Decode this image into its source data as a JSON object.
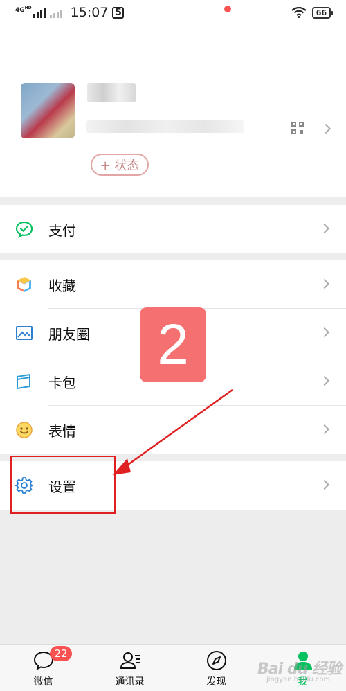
{
  "status_bar": {
    "network": "4G",
    "network_sup": "HD",
    "time": "15:07",
    "app_icon": "S",
    "battery": "66"
  },
  "profile": {
    "status_button": "+ 状态"
  },
  "menu": {
    "pay": "支付",
    "favorites": "收藏",
    "moments": "朋友圈",
    "cards": "卡包",
    "stickers": "表情",
    "settings": "设置"
  },
  "tabbar": {
    "chats": "微信",
    "chats_badge": "22",
    "contacts": "通讯录",
    "discover": "发现",
    "me": "我"
  },
  "annotation": {
    "step_number": "2"
  },
  "watermark": {
    "brand": "Bai du 经验",
    "sub": "jingyan.baidu.com"
  },
  "colors": {
    "accent_green": "#07c160",
    "badge_red": "#fa5151",
    "annotation_red": "#e02020"
  }
}
